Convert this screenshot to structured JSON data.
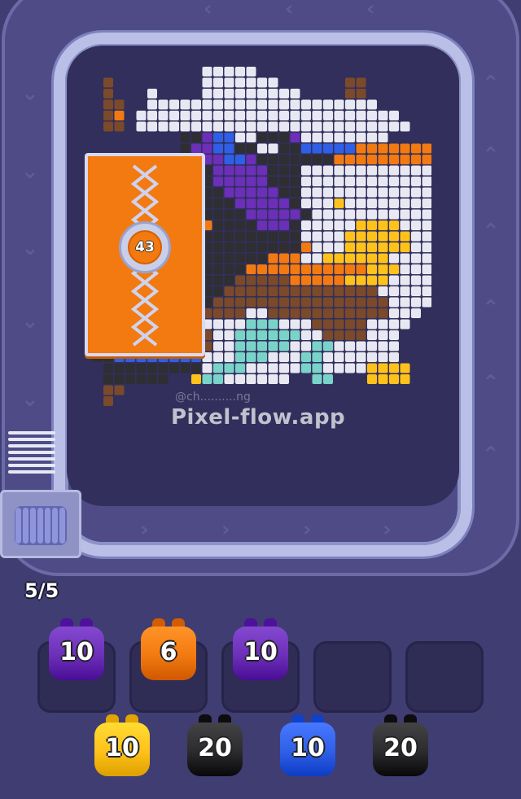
{
  "title_fragment": "",
  "locked_block": {
    "count": "43",
    "color": "#f27a10"
  },
  "watermark": {
    "text": "Pixel-flow.app",
    "sub": "@ch..........ng"
  },
  "queue_counter": "5/5",
  "colors": {
    "purple": "#6b2fb8",
    "orange": "#f27a10",
    "yellow": "#ffc21a",
    "black": "#2b2b2e",
    "blue": "#2f5fe6",
    "background": "#3f3d72"
  },
  "active_slots": [
    {
      "value": "10",
      "color": "purple"
    },
    {
      "value": "6",
      "color": "orange"
    },
    {
      "value": "10",
      "color": "purple"
    },
    {
      "value": "",
      "color": "empty"
    },
    {
      "value": "",
      "color": "empty"
    }
  ],
  "waiting_pieces": [
    {
      "value": "10",
      "color": "yellow"
    },
    {
      "value": "20",
      "color": "black"
    },
    {
      "value": "10",
      "color": "blue"
    },
    {
      "value": "20",
      "color": "black"
    }
  ]
}
